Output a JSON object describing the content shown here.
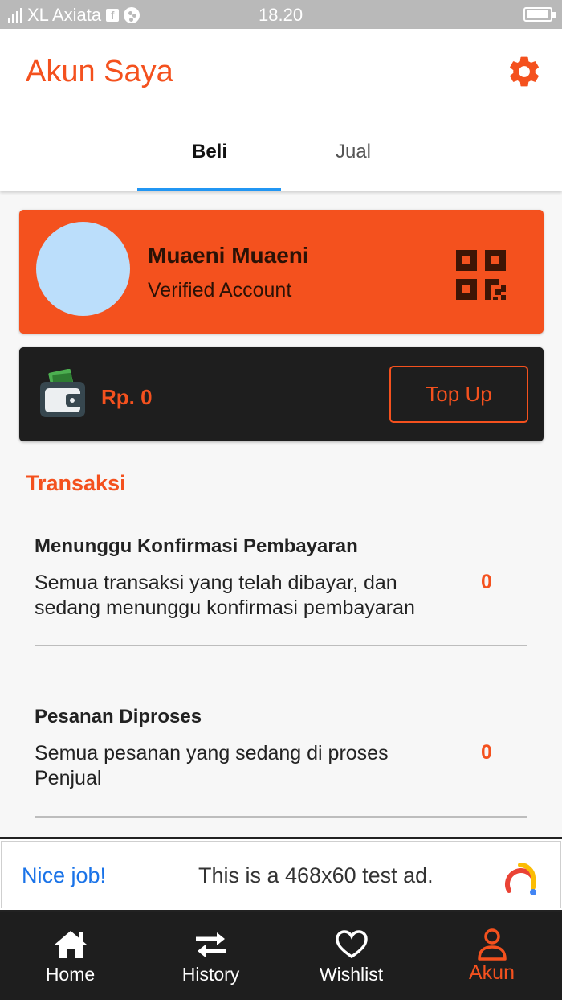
{
  "status_bar": {
    "carrier": "XL Axiata",
    "time": "18.20"
  },
  "header": {
    "title": "Akun Saya",
    "settings_icon": "gear-icon",
    "tabs": [
      {
        "label": "Beli",
        "active": true
      },
      {
        "label": "Jual",
        "active": false
      }
    ]
  },
  "profile": {
    "name": "Muaeni Muaeni",
    "status": "Verified Account",
    "qr_icon": "qr-code-icon"
  },
  "wallet": {
    "balance": "Rp. 0",
    "topup_label": "Top Up",
    "icon": "wallet-icon"
  },
  "transactions": {
    "section_title": "Transaksi",
    "items": [
      {
        "title": "Menunggu Konfirmasi Pembayaran",
        "description": "Semua transaksi yang telah dibayar, dan sedang menunggu konfirmasi pembayaran",
        "count": "0"
      },
      {
        "title": "Pesanan Diproses",
        "description": "Semua pesanan yang sedang di proses Penjual",
        "count": "0"
      }
    ]
  },
  "ad": {
    "headline": "Nice job!",
    "text": "This is a 468x60 test ad."
  },
  "bottom_nav": {
    "items": [
      {
        "label": "Home",
        "icon": "home-icon",
        "active": false
      },
      {
        "label": "History",
        "icon": "swap-arrows-icon",
        "active": false
      },
      {
        "label": "Wishlist",
        "icon": "heart-icon",
        "active": false
      },
      {
        "label": "Akun",
        "icon": "user-icon",
        "active": true
      }
    ]
  },
  "colors": {
    "accent": "#f4511e",
    "tab_indicator": "#2196f3",
    "dark_card": "#1e1e1e",
    "avatar": "#bbdefb",
    "ad_headline": "#1a73e8"
  }
}
